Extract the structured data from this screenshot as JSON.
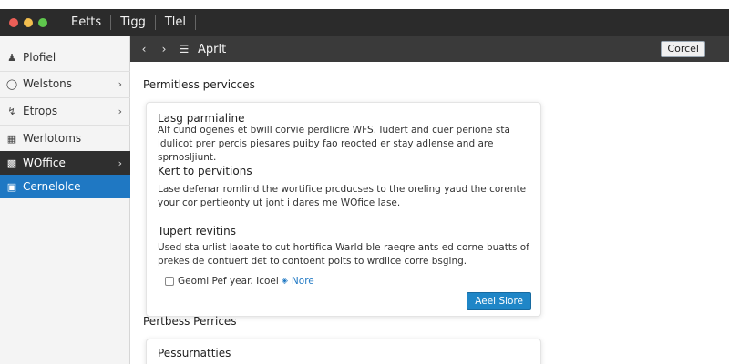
{
  "window": {
    "traffic_colors": [
      "#ec5f57",
      "#f4bf4f",
      "#5fc74d"
    ],
    "menu": [
      "Eetts",
      "Tigg",
      "Tlel"
    ]
  },
  "sidebar": {
    "items": [
      {
        "label": "Plofiel",
        "icon": "person-icon",
        "chevron": false
      },
      {
        "label": "Welstons",
        "icon": "globe-icon",
        "chevron": true
      },
      {
        "label": "Etrops",
        "icon": "wrench-icon",
        "chevron": true
      },
      {
        "label": "Werlotoms",
        "icon": "grid-icon",
        "chevron": false
      },
      {
        "label": "WOffice",
        "icon": "office-icon",
        "chevron": true,
        "state": "dark"
      },
      {
        "label": "Cernelolce",
        "icon": "app-icon",
        "chevron": false,
        "state": "selected"
      }
    ],
    "selected_color": "#1f78c3"
  },
  "toolbar": {
    "back": "‹",
    "forward": "›",
    "title": "Aprlt",
    "cancel_label": "Corcel"
  },
  "main": {
    "section_title": "Permitless pervicces",
    "card": {
      "sections": [
        {
          "heading": "Lasg parmialine",
          "body": "Alf cund ogenes et bwill corvie perdlicre WFS. Iudert and cuer perione sta idulicot prer percis piesares puiby fao reocted er stay adlense and are sprnosljiunt."
        },
        {
          "heading": "Kert to pervitions",
          "body": "Lase defenar romlind the wortifice prcducses to the oreling yaud the corente your cor pertieonty ut jont i dares me WOfice lase."
        },
        {
          "heading": "Tupert revitins",
          "body": "Used sta urlist laoate to cut hortifica Warld ble raeqre ants ed corne buatts of prekes de contuert det to contoent polts to wrdilce corre bsging."
        }
      ],
      "checkbox1_label": "Geomi Pef year. Icoel",
      "checkbox2_label": "Nore",
      "apply_label": "Aeel Slore"
    },
    "section_title2": "Pertbess Perrices",
    "card2_heading": "Pessurnatties"
  }
}
